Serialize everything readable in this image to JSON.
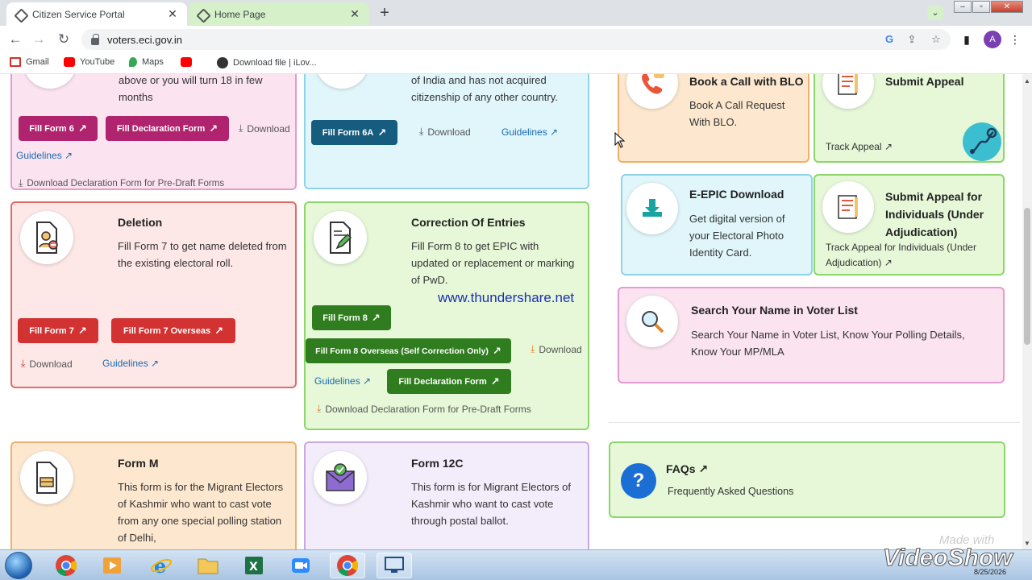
{
  "browser": {
    "tabs": [
      {
        "title": "Citizen Service Portal",
        "active": true
      },
      {
        "title": "Home Page",
        "active": false
      }
    ],
    "new_tab": "+",
    "url": "voters.eci.gov.in",
    "profile_initial": "A",
    "bookmarks": [
      "Gmail",
      "YouTube",
      "Maps",
      "",
      "Download file | iLov..."
    ]
  },
  "page": {
    "card_pink_top": {
      "desc_partial": "above or you will turn 18 in few months",
      "buttons": [
        "Fill Form 6",
        "Fill Declaration Form"
      ],
      "download": "Download",
      "guidelines": "Guidelines",
      "download_decl": "Download Declaration Form for Pre-Draft Forms"
    },
    "card_blue_top": {
      "desc_partial": "of India and has not acquired citizenship of any other country.",
      "button": "Fill Form 6A",
      "download": "Download",
      "guidelines": "Guidelines"
    },
    "deletion": {
      "title": "Deletion",
      "desc": "Fill Form 7 to get name deleted from the existing electoral roll.",
      "buttons": [
        "Fill Form 7",
        "Fill Form 7 Overseas"
      ],
      "download": "Download",
      "guidelines": "Guidelines"
    },
    "correction": {
      "title": "Correction Of Entries",
      "desc": "Fill Form 8 to get EPIC with updated or replacement or marking of PwD.",
      "buttons": [
        "Fill Form 8",
        "Fill Form 8 Overseas (Self Correction Only)",
        "Fill Declaration Form"
      ],
      "download": "Download",
      "guidelines": "Guidelines",
      "download_decl": "Download Declaration Form for Pre-Draft Forms"
    },
    "watermark_url": "www.thundershare.net",
    "form_m": {
      "title": "Form M",
      "desc": "This form is for the Migrant Electors of Kashmir who want to cast vote from any one special polling station of Delhi,"
    },
    "form_12c": {
      "title": "Form 12C",
      "desc": "This form is for Migrant Electors of Kashmir who want to cast vote through postal ballot."
    },
    "blo": {
      "title": "Book a Call with BLO",
      "desc": "Book A Call Request With BLO."
    },
    "appeal": {
      "title": "Submit Appeal",
      "link": "Track Appeal"
    },
    "epic": {
      "title": "E-EPIC Download",
      "desc": "Get digital version of your Electoral Photo Identity Card."
    },
    "appeal_individual": {
      "title": "Submit Appeal for Individuals (Under Adjudication)",
      "link": "Track Appeal for Individuals (Under Adjudication)"
    },
    "search": {
      "title": "Search Your Name in Voter List",
      "desc": "Search Your Name in Voter List, Know Your Polling Details, Know Your MP/MLA"
    },
    "faq": {
      "title": "FAQs",
      "desc": "Frequently Asked Questions",
      "icon_text": "?"
    }
  },
  "overlay": {
    "made_with": "Made with",
    "videoshow": "VideoShow",
    "date": "8/25/2026"
  },
  "colors": {
    "purple_btn": "#b0246f",
    "teal_btn": "#165c7e",
    "red_btn": "#d23232",
    "green_btn": "#2f7d1f",
    "link_blue": "#1a6bb0"
  }
}
